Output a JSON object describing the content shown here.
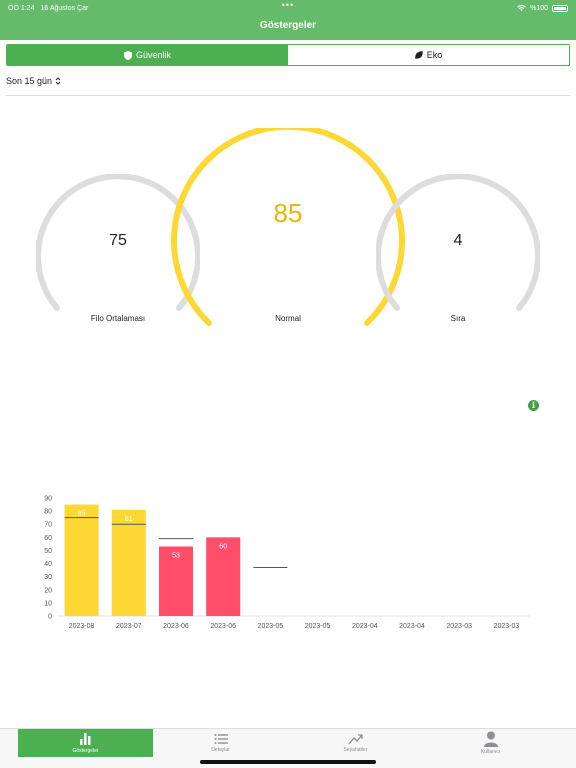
{
  "status": {
    "time": "ÖÖ 1:24",
    "date": "16 Ağustos Çar",
    "dots": "•••",
    "battery": "%100"
  },
  "header": {
    "title": "Göstergeler"
  },
  "segments": [
    {
      "label": "Güvenlik",
      "icon": "shield-icon",
      "active": true
    },
    {
      "label": "Eko",
      "icon": "leaf-icon",
      "active": false
    }
  ],
  "period": {
    "label": "Son 15 gün",
    "icon": "chevron-updown-icon"
  },
  "gauges": [
    {
      "value": "75",
      "label": "Filo Ortalaması",
      "color": "#dddddd",
      "text_color": "#222222",
      "level": 0
    },
    {
      "value": "85",
      "label": "Normal",
      "color": "#fdd835",
      "text_color": "#e6b800",
      "level": 85
    },
    {
      "value": "4",
      "label": "Sıra",
      "color": "#dddddd",
      "text_color": "#222222",
      "level": 0
    }
  ],
  "info_icon": "info-icon",
  "chart_data": {
    "type": "bar",
    "categories": [
      "2023-08",
      "2023-07",
      "2023-06",
      "2023-06",
      "2023-05",
      "2023-05",
      "2023-04",
      "2023-04",
      "2023-03",
      "2023-03"
    ],
    "values": [
      85,
      81,
      53,
      60,
      null,
      null,
      null,
      null,
      null,
      null
    ],
    "data_labels": [
      "85",
      "81",
      "53",
      "60",
      "",
      "",
      "",
      "",
      "",
      ""
    ],
    "bar_colors": [
      "#fdd835",
      "#fdd835",
      "#ff4d6a",
      "#ff4d6a",
      null,
      null,
      null,
      null,
      null,
      null
    ],
    "reference_lines": [
      75,
      70,
      59,
      null,
      37,
      null,
      null,
      null,
      null,
      null
    ],
    "yticks": [
      "0",
      "10",
      "20",
      "30",
      "40",
      "50",
      "60",
      "70",
      "80",
      "90"
    ],
    "ylim": [
      0,
      90
    ],
    "title": "",
    "xlabel": "",
    "ylabel": ""
  },
  "tabs": [
    {
      "label": "Göstergeler",
      "icon": "bar-chart-icon",
      "active": true
    },
    {
      "label": "Detaylar",
      "icon": "list-icon",
      "active": false
    },
    {
      "label": "Seyahatler",
      "icon": "trend-icon",
      "active": false
    },
    {
      "label": "Kullanıcı",
      "icon": "person-icon",
      "active": false
    }
  ]
}
